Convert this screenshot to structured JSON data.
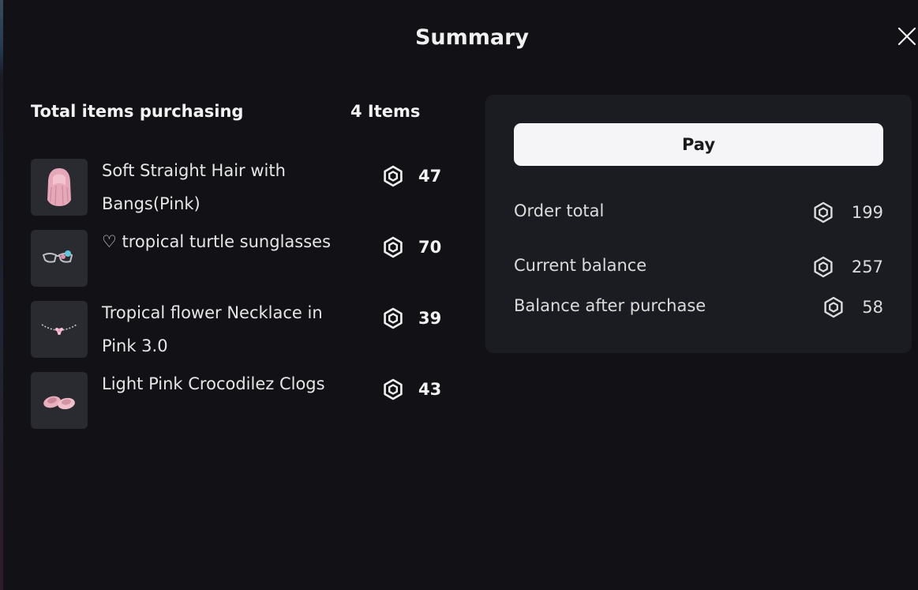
{
  "modal": {
    "title": "Summary"
  },
  "items_header": {
    "label": "Total items purchasing",
    "count": "4 Items"
  },
  "items": [
    {
      "name": "Soft Straight Hair with Bangs(Pink)",
      "price": "47",
      "icon": "pink-hair-thumbnail"
    },
    {
      "name": "♡ tropical turtle sunglasses",
      "price": "70",
      "icon": "sunglasses-thumbnail"
    },
    {
      "name": "Tropical flower Necklace in Pink 3.0",
      "price": "39",
      "icon": "necklace-thumbnail"
    },
    {
      "name": "Light Pink Crocodilez Clogs",
      "price": "43",
      "icon": "clogs-thumbnail"
    }
  ],
  "summary": {
    "pay_label": "Pay",
    "order_total_label": "Order total",
    "order_total_value": "199",
    "current_balance_label": "Current balance",
    "current_balance_value": "257",
    "after_label": "Balance after purchase",
    "after_value": "58"
  },
  "colors": {
    "background": "#121216",
    "panel": "#1b1c21",
    "pay_button": "#f5f5f7"
  }
}
